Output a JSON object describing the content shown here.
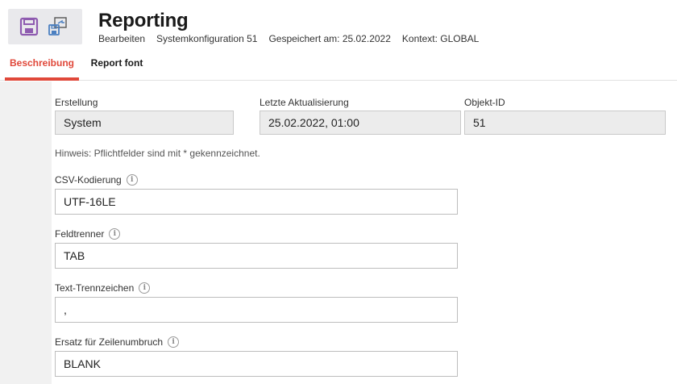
{
  "header": {
    "title": "Reporting",
    "meta": [
      "Bearbeiten",
      "Systemkonfiguration 51",
      "Gespeichert am: 25.02.2022",
      "Kontext: GLOBAL"
    ]
  },
  "toolbar": {
    "save_icon": "floppy-disk-icon",
    "export_icon": "save-export-icon"
  },
  "tabs": [
    {
      "label": "Beschreibung",
      "active": true
    },
    {
      "label": "Report font",
      "active": false
    }
  ],
  "info_row": [
    {
      "label": "Erstellung",
      "value": "System"
    },
    {
      "label": "Letzte Aktualisierung",
      "value": "25.02.2022, 01:00"
    },
    {
      "label": "Objekt-ID",
      "value": "51"
    }
  ],
  "hint": "Hinweis: Pflichtfelder sind mit * gekennzeichnet.",
  "fields": [
    {
      "label": "CSV-Kodierung",
      "value": "UTF-16LE"
    },
    {
      "label": "Feldtrenner",
      "value": "TAB"
    },
    {
      "label": "Text-Trennzeichen",
      "value": ","
    },
    {
      "label": "Ersatz für Zeilenumbruch",
      "value": "BLANK"
    }
  ],
  "colors": {
    "accent": "#e0483a",
    "icon": "#8e5bb0"
  }
}
